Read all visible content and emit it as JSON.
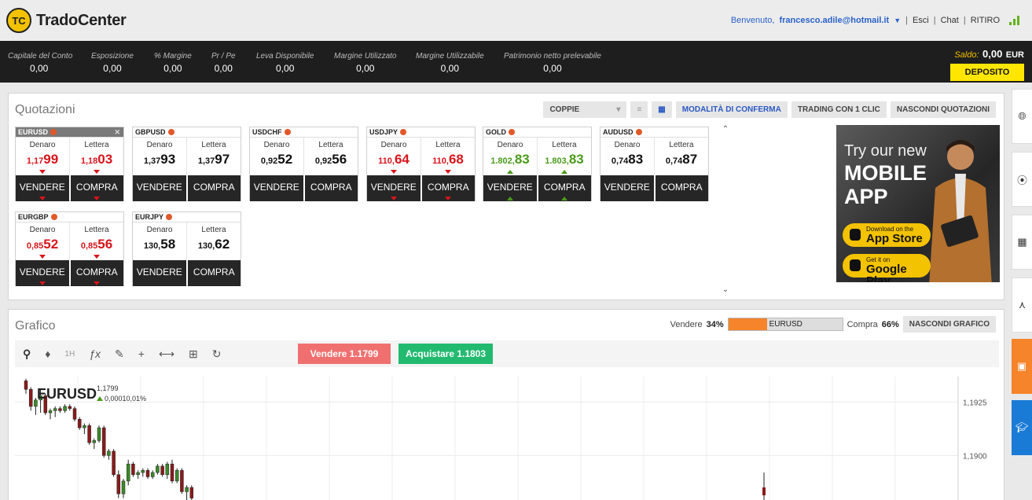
{
  "brand": {
    "badge": "TC",
    "name": "TradoCenter"
  },
  "topnav": {
    "welcome": "Benvenuto,",
    "email": "francesco.adile@hotmail.it",
    "caret": "▼",
    "links": [
      "Esci",
      "Chat",
      "RITIRO"
    ],
    "sep": "|"
  },
  "account": {
    "items": [
      {
        "label": "Capitale del Conto",
        "value": "0,00"
      },
      {
        "label": "Esposizione",
        "value": "0,00"
      },
      {
        "label": "% Margine",
        "value": "0,00"
      },
      {
        "label": "Pr / Pe",
        "value": "0,00"
      },
      {
        "label": "Leva Disponibile",
        "value": "0,00"
      },
      {
        "label": "Margine Utilizzato",
        "value": "0,00"
      },
      {
        "label": "Margine Utilizzabile",
        "value": "0,00"
      },
      {
        "label": "Patrimonio netto prelevabile",
        "value": "0,00"
      }
    ],
    "saldo_label": "Saldo:",
    "saldo_value": "0,00",
    "currency": "EUR",
    "deposit": "DEPOSITO"
  },
  "quotazioni": {
    "title": "Quotazioni",
    "dropdown": "COPPIE",
    "confirm_mode": "MODALITÀ DI CONFERMA",
    "one_click": "TRADING CON 1 CLIC",
    "hide": "NASCONDI QUOTAZIONI",
    "bid_label": "Denaro",
    "ask_label": "Lettera",
    "sell": "VENDERE",
    "buy": "COMPRA",
    "tiles": [
      {
        "symbol": "EURUSD",
        "bid_small": "1,17",
        "bid_big": "99",
        "ask_small": "1,18",
        "ask_big": "03",
        "dir": "down"
      },
      {
        "symbol": "GBPUSD",
        "bid_small": "1,37",
        "bid_big": "93",
        "ask_small": "1,37",
        "ask_big": "97",
        "dir": "none"
      },
      {
        "symbol": "USDCHF",
        "bid_small": "0,92",
        "bid_big": "52",
        "ask_small": "0,92",
        "ask_big": "56",
        "dir": "none"
      },
      {
        "symbol": "USDJPY",
        "bid_small": "110,",
        "bid_big": "64",
        "ask_small": "110,",
        "ask_big": "68",
        "dir": "down"
      },
      {
        "symbol": "GOLD",
        "bid_small": "1.802,",
        "bid_big": "83",
        "ask_small": "1.803,",
        "ask_big": "83",
        "dir": "up"
      },
      {
        "symbol": "AUDUSD",
        "bid_small": "0,74",
        "bid_big": "83",
        "ask_small": "0,74",
        "ask_big": "87",
        "dir": "none"
      },
      {
        "symbol": "EURGBP",
        "bid_small": "0,85",
        "bid_big": "52",
        "ask_small": "0,85",
        "ask_big": "56",
        "dir": "down"
      },
      {
        "symbol": "EURJPY",
        "bid_small": "130,",
        "bid_big": "58",
        "ask_small": "130,",
        "ask_big": "62",
        "dir": "none"
      }
    ],
    "ad": {
      "line1": "Try our new",
      "line2": "MOBILE",
      "line3": "APP",
      "appstore_small": "Download on the",
      "appstore": "App Store",
      "gplay_small": "Get it on",
      "gplay": "Google Play"
    }
  },
  "grafico": {
    "title": "Grafico",
    "sell_label": "Vendere",
    "sell_pct": "34%",
    "sell_fraction": 0.34,
    "symbol": "EURUSD",
    "buy_label": "Compra",
    "buy_pct": "66%",
    "hide": "NASCONDI GRAFICO",
    "timeframe": "1H",
    "sell_btn": "Vendere 1.1799",
    "buy_btn": "Acquistare 1.1803",
    "chart_symbol": "EURUSD",
    "chart_price": "1,1799",
    "chart_change": "0,00010,01%",
    "axis_labels": [
      "1,1925",
      "1,1900"
    ]
  },
  "chart_data": {
    "type": "candlestick",
    "title": "EURUSD",
    "ylabel": "",
    "y_ticks": [
      1.1925,
      1.19
    ],
    "ylim": [
      1.1878,
      1.1937
    ],
    "candles": [
      [
        1.1935,
        1.1936,
        1.1929,
        1.1931
      ],
      [
        1.1931,
        1.1932,
        1.1921,
        1.1923
      ],
      [
        1.1923,
        1.1927,
        1.1919,
        1.1926
      ],
      [
        1.1926,
        1.1931,
        1.192,
        1.1928
      ],
      [
        1.1928,
        1.1929,
        1.1919,
        1.192
      ],
      [
        1.192,
        1.1922,
        1.1917,
        1.1921
      ],
      [
        1.1921,
        1.1923,
        1.1918,
        1.1922
      ],
      [
        1.1922,
        1.1923,
        1.192,
        1.1921
      ],
      [
        1.1921,
        1.1924,
        1.192,
        1.1923
      ],
      [
        1.1923,
        1.1924,
        1.1921,
        1.1922
      ],
      [
        1.1922,
        1.1923,
        1.1916,
        1.1917
      ],
      [
        1.1917,
        1.1918,
        1.1912,
        1.1913
      ],
      [
        1.1913,
        1.1915,
        1.191,
        1.1914
      ],
      [
        1.1914,
        1.1915,
        1.1905,
        1.1906
      ],
      [
        1.1906,
        1.1908,
        1.1903,
        1.1907
      ],
      [
        1.1907,
        1.1914,
        1.1906,
        1.1913
      ],
      [
        1.1913,
        1.1914,
        1.1899,
        1.19
      ],
      [
        1.19,
        1.1903,
        1.1898,
        1.1902
      ],
      [
        1.1902,
        1.1903,
        1.189,
        1.1891
      ],
      [
        1.1891,
        1.1893,
        1.188,
        1.1882
      ],
      [
        1.1882,
        1.1889,
        1.188,
        1.1888
      ],
      [
        1.1888,
        1.1898,
        1.1886,
        1.1896
      ],
      [
        1.1896,
        1.1897,
        1.189,
        1.1891
      ],
      [
        1.1891,
        1.1893,
        1.1889,
        1.1892
      ],
      [
        1.1892,
        1.1894,
        1.189,
        1.1893
      ],
      [
        1.1893,
        1.1894,
        1.1889,
        1.189
      ],
      [
        1.189,
        1.1893,
        1.1889,
        1.1892
      ],
      [
        1.1892,
        1.1896,
        1.1891,
        1.1895
      ],
      [
        1.1895,
        1.1896,
        1.189,
        1.1891
      ],
      [
        1.1891,
        1.1897,
        1.1889,
        1.1896
      ],
      [
        1.1896,
        1.1898,
        1.1887,
        1.1888
      ],
      [
        1.1888,
        1.1894,
        1.1887,
        1.1893
      ],
      [
        1.1893,
        1.1894,
        1.1882,
        1.1883
      ],
      [
        1.1883,
        1.1886,
        1.1879,
        1.1885
      ],
      [
        1.1885,
        1.1886,
        1.1878,
        1.188
      ]
    ]
  },
  "side_icons": [
    "globe-icon",
    "play-circle-icon",
    "calendar-icon",
    "pulse-icon",
    "contract-icon",
    "graduation-cap-icon"
  ]
}
